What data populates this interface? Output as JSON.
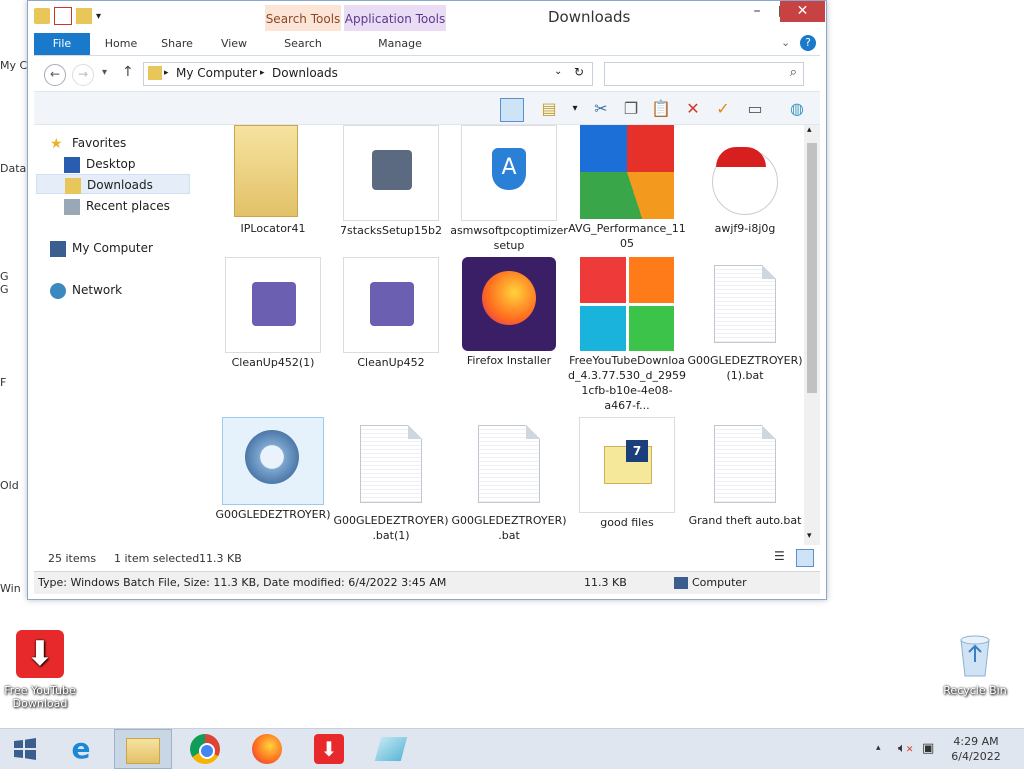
{
  "window": {
    "title": "Downloads",
    "context_tabs": [
      "Search Tools",
      "Application Tools"
    ],
    "controls": {
      "minimize": "–",
      "maximize": "□",
      "close": "✕"
    }
  },
  "ribbon": {
    "tabs": [
      "File",
      "Home",
      "Share",
      "View",
      "Search",
      "Manage"
    ]
  },
  "address": {
    "path": [
      "My Computer",
      "Downloads"
    ],
    "search_placeholder": ""
  },
  "nav": {
    "favorites": "Favorites",
    "desktop": "Desktop",
    "downloads": "Downloads",
    "recent": "Recent places",
    "computer": "My Computer",
    "network": "Network"
  },
  "files": [
    {
      "name": "IPLocator41"
    },
    {
      "name": "7stacksSetup15b2"
    },
    {
      "name": "asmwsoftpcoptimizersetup"
    },
    {
      "name": "AVG_Performance_1105"
    },
    {
      "name": "awjf9-i8j0g"
    },
    {
      "name": "CleanUp452(1)"
    },
    {
      "name": "CleanUp452"
    },
    {
      "name": "Firefox Installer"
    },
    {
      "name": "FreeYouTubeDownload_4.3.77.530_d_29591cfb-b10e-4e08-a467-f..."
    },
    {
      "name": "G00GLEDEZTROYER)(1).bat"
    },
    {
      "name": "G00GLEDEZTROYER)"
    },
    {
      "name": "G00GLEDEZTROYER).bat(1)"
    },
    {
      "name": "G00GLEDEZTROYER).bat"
    },
    {
      "name": "good files"
    },
    {
      "name": "Grand theft auto.bat"
    }
  ],
  "status": {
    "count": "25 items",
    "selected": "1 item selected",
    "size": "11.3 KB"
  },
  "details": {
    "text": "Type: Windows Batch File, Size: 11.3 KB, Date modified: 6/4/2022 3:45 AM",
    "size": "11.3 KB",
    "location": "Computer"
  },
  "desktop": {
    "fyd": "Free YouTube Download",
    "recycle": "Recycle Bin",
    "left_labels": [
      "My C",
      "Data",
      "G",
      "G",
      "F",
      "Old",
      "Win"
    ]
  },
  "clock": {
    "time": "4:29 AM",
    "date": "6/4/2022"
  },
  "colors": {
    "accent": "#1979ca",
    "close": "#c74343",
    "search_tools_tab": "#fce4d6",
    "app_tools_tab": "#eadcf5"
  }
}
